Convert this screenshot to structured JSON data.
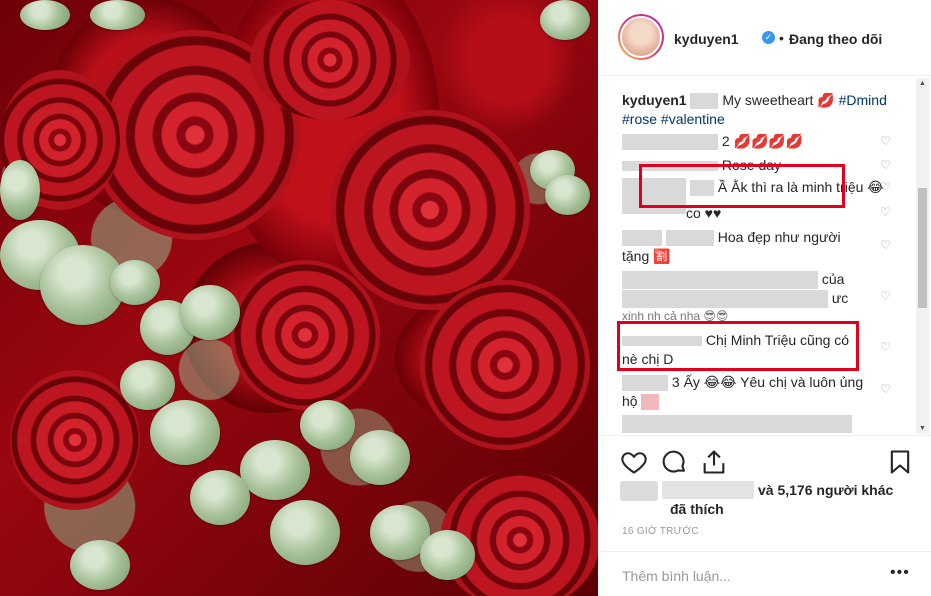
{
  "post": {
    "username": "kyduyen1",
    "follow_dot": "•",
    "follow_label": "Đang theo dõi"
  },
  "caption": {
    "username": "kyduyen1",
    "text": "My sweetheart 💋",
    "tags": [
      "#Dmind",
      "#rose",
      "#valentine"
    ]
  },
  "comments": [
    {
      "text": "2 💋💋💋💋"
    },
    {
      "text": "Rose day"
    },
    {
      "text": "Ầ Ằk thì ra là minh triệu 😂"
    },
    {
      "text": "co ♥♥"
    },
    {
      "text": "Hoa đẹp như người"
    },
    {
      "text": "tặng 🈹"
    },
    {
      "text": "của"
    },
    {
      "text": "ưc"
    },
    {
      "text": "xinh nh   cả nha 😎😎"
    },
    {
      "text": "Chị Minh Triệu cũng có"
    },
    {
      "text": "nè chị D"
    },
    {
      "text": "3 Ấy 😂😂 Yêu chị và luôn ủng"
    },
    {
      "text": "hộ"
    }
  ],
  "likes": {
    "count_text": "và 5,176 người khác",
    "liked_label": "đã thích"
  },
  "time": "16 GIỜ TRƯỚC",
  "add_comment": {
    "placeholder": "Thêm bình luận...",
    "more": "•••"
  },
  "icons": {
    "heart": "heart-icon",
    "comment": "comment-icon",
    "share": "share-icon",
    "save": "bookmark-icon",
    "verified": "verified-badge-icon"
  },
  "colors": {
    "link": "#003569",
    "verified": "#3897f0",
    "highlight_box": "#e0001b"
  }
}
